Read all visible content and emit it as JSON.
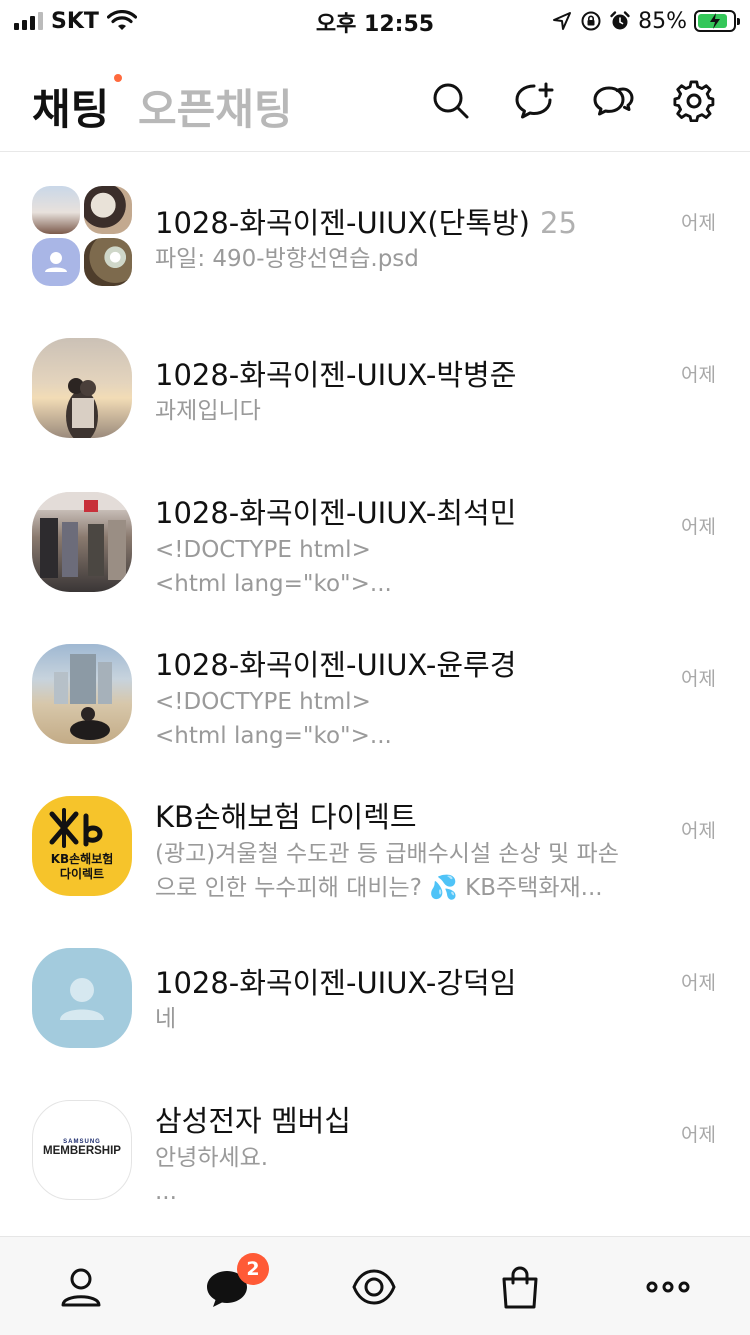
{
  "status_bar": {
    "carrier": "SKT",
    "time": "오후 12:55",
    "battery_percent": "85%",
    "battery_level": 0.85,
    "icons": [
      "signal-icon",
      "wifi-icon",
      "location-icon",
      "orientation-lock-icon",
      "alarm-icon",
      "battery-charging-icon"
    ]
  },
  "header": {
    "tab_chat": "채팅",
    "tab_open_chat": "오픈채팅",
    "icons": [
      "search-icon",
      "new-chat-icon",
      "open-chat-icon",
      "settings-icon"
    ]
  },
  "chats": [
    {
      "title": "1028-화곡이젠-UIUX(단톡방)",
      "member_count": "25",
      "preview": [
        "파일: 490-방향선연습.psd"
      ],
      "time": "어제",
      "avatar": "group"
    },
    {
      "title": "1028-화곡이젠-UIUX-박병준",
      "preview": [
        "과제입니다"
      ],
      "time": "어제",
      "avatar": "photo-sunset"
    },
    {
      "title": "1028-화곡이젠-UIUX-최석민",
      "preview": [
        "<!DOCTYPE html>",
        "<html lang=\"ko\">..."
      ],
      "time": "어제",
      "avatar": "photo-store"
    },
    {
      "title": "1028-화곡이젠-UIUX-윤루경",
      "preview": [
        "<!DOCTYPE html>",
        "<html lang=\"ko\">..."
      ],
      "time": "어제",
      "avatar": "photo-beach"
    },
    {
      "title": "KB손해보험 다이렉트",
      "preview": [
        "(광고)겨울철 수도관 등 급배수시설 손상 및 파손",
        "으로 인한 누수피해 대비는? 💦 KB주택화재..."
      ],
      "time": "어제",
      "avatar": "kb-logo"
    },
    {
      "title": "1028-화곡이젠-UIUX-강덕임",
      "preview": [
        "네"
      ],
      "time": "어제",
      "avatar": "default-profile"
    },
    {
      "title": "삼성전자 멤버십",
      "preview": [
        "안녕하세요.",
        "..."
      ],
      "time": "어제",
      "avatar": "samsung-membership-logo"
    }
  ],
  "logos": {
    "kb_lines": [
      "KB손해보험",
      "다이렉트"
    ],
    "samsung_small": "SAMSUNG",
    "samsung_big": "MEMBERSHIP"
  },
  "tab_bar": {
    "chat_badge": "2",
    "icons": [
      "friends-icon",
      "chats-icon",
      "view-icon",
      "shopping-icon",
      "more-icon"
    ]
  },
  "colors": {
    "accent_dot": "#ff6a3d",
    "badge": "#ff5a36",
    "kb_yellow": "#f6c42b",
    "battery_green": "#34c759",
    "default_avatar_blue": "#a3cbdd"
  }
}
